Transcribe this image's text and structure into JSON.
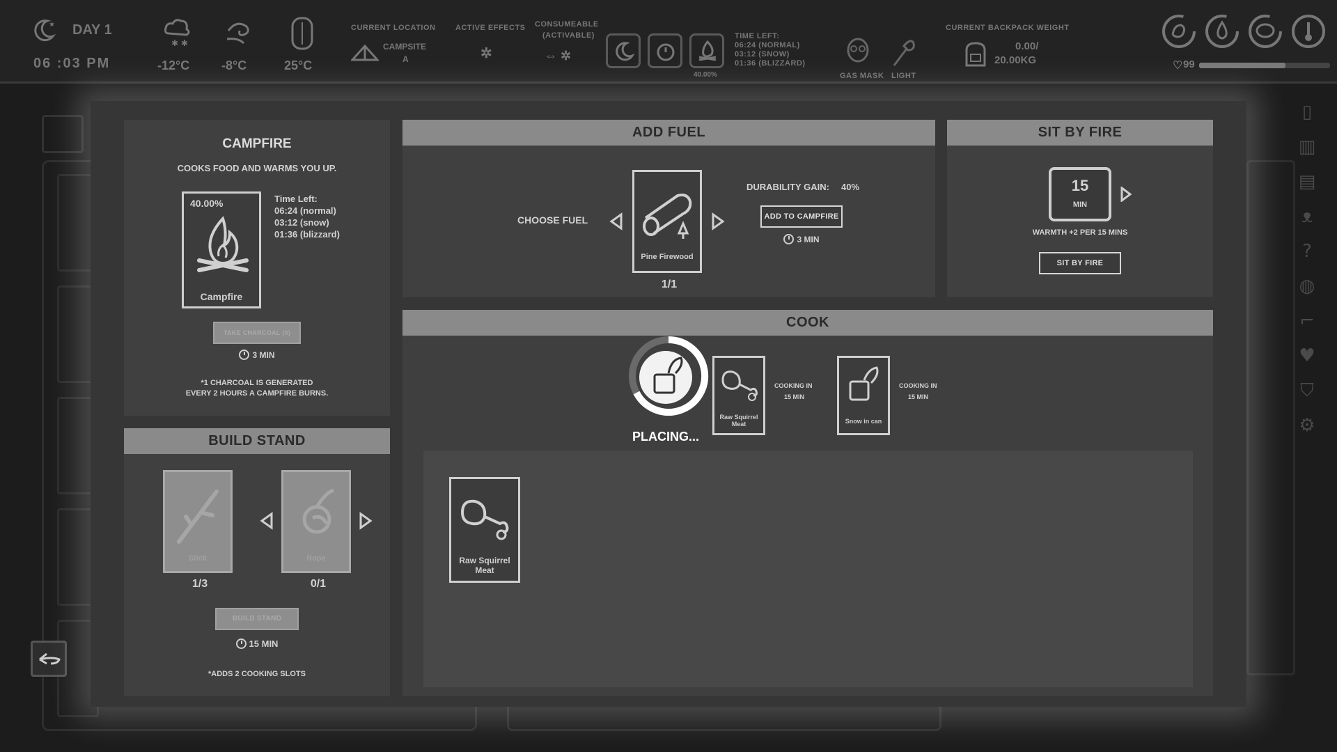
{
  "hud": {
    "day": "DAY 1",
    "time": "06 :03 PM",
    "temps": [
      "-12°C",
      "-8°C",
      "25°C"
    ],
    "current_location_label": "CURRENT LOCATION",
    "location_name": "CAMPSITE",
    "location_sub": "A",
    "active_effects_label": "ACTIVE EFFECTS",
    "consumeable_label": "CONSUMEABLE",
    "activable_label": "(ACTIVABLE)",
    "consumable_percent": "40.00%",
    "time_left_label": "TIME LEFT:",
    "time_left_normal": "06:24 (NORMAL)",
    "time_left_snow": "03:12 (SNOW)",
    "time_left_blizzard": "01:36 (BLIZZARD)",
    "gas_mask_label": "GAS MASK",
    "light_label": "LIGHT",
    "backpack_label": "CURRENT BACKPACK WEIGHT",
    "backpack_current": "0.00/",
    "backpack_max": "20.00KG",
    "status_value": "99",
    "status_bar_fraction": 0.66,
    "status_icons": [
      "stomach-icon",
      "water-drop-icon",
      "brain-icon",
      "thermometer-icon"
    ]
  },
  "campfire": {
    "title": "CAMPFIRE",
    "subtitle": "COOKS FOOD AND WARMS YOU UP.",
    "percent": "40.00%",
    "card_name": "Campfire",
    "time_left_label": "Time Left:",
    "time_normal": "06:24 (normal)",
    "time_snow": "03:12 (snow)",
    "time_blizzard": "01:36 (blizzard)",
    "take_charcoal": "TAKE CHARCOAL (0)",
    "charcoal_time": "3 MIN",
    "note_line1": "*1 CHARCOAL IS GENERATED",
    "note_line2": "EVERY 2 HOURS A CAMPFIRE BURNS."
  },
  "build_stand": {
    "title": "BUILD STAND",
    "stick_name": "Stick",
    "stick_count": "1/3",
    "rope_name": "Rope",
    "rope_count": "0/1",
    "button": "BUILD STAND",
    "time": "15 MIN",
    "note": "*ADDS 2 COOKING SLOTS"
  },
  "add_fuel": {
    "title": "ADD FUEL",
    "choose_label": "CHOOSE FUEL",
    "fuel_name": "Pine Firewood",
    "fuel_count": "1/1",
    "durability_label": "DURABILITY GAIN:",
    "durability_value": "40%",
    "button": "ADD TO CAMPFIRE",
    "time": "3 MIN"
  },
  "sit_by_fire": {
    "title": "SIT BY FIRE",
    "minutes": "15",
    "min_label": "MIN",
    "warmth_text": "WARMTH +2 PER 15 MINS",
    "button": "SIT BY FIRE"
  },
  "cook": {
    "title": "COOK",
    "placing_text": "PLACING...",
    "slots": [
      {
        "name": "Raw Squirrel Meat",
        "status_line1": "COOKING IN",
        "status_line2": "15 MIN"
      },
      {
        "name": "Snow in can",
        "status_line1": "COOKING IN",
        "status_line2": "15 MIN"
      }
    ],
    "inventory": [
      {
        "name_line1": "Raw Squirrel",
        "name_line2": "Meat"
      }
    ]
  }
}
